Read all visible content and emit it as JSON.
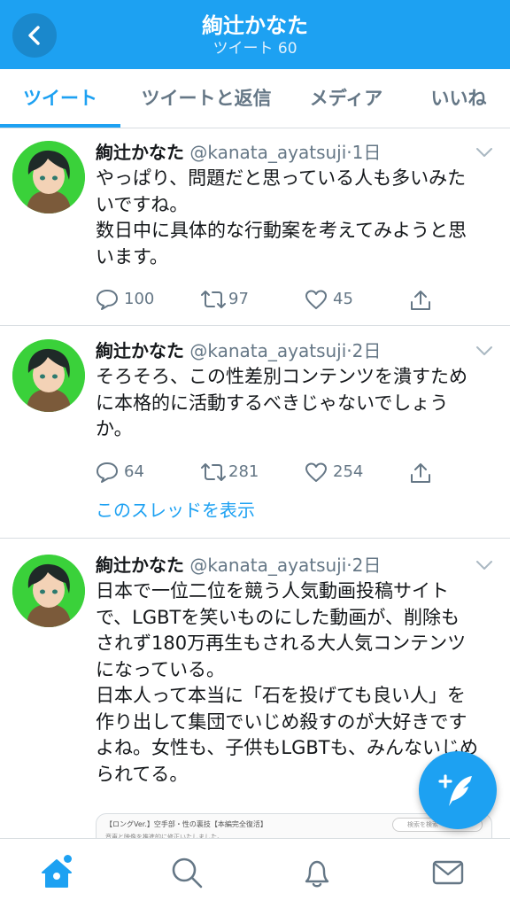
{
  "header": {
    "title": "絢辻かなた",
    "subtitle": "ツイート 60",
    "color": "#1da1f2"
  },
  "tabs": [
    {
      "label": "ツイート",
      "active": true
    },
    {
      "label": "ツイートと返信",
      "active": false
    },
    {
      "label": "メディア",
      "active": false
    },
    {
      "label": "いいね",
      "active": false
    }
  ],
  "tweets": [
    {
      "name": "絢辻かなた",
      "meta": "@kanata_ayatsuji·1日",
      "lines": [
        "やっぱり、問題だと思っている人も多いみた",
        "いですね。",
        "数日中に具体的な行動案を考えてみようと思",
        "います。"
      ],
      "replies": "100",
      "retweets": "97",
      "likes": "45"
    },
    {
      "name": "絢辻かなた",
      "meta": "@kanata_ayatsuji·2日",
      "lines": [
        "そろそろ、この性差別コンテンツを潰すため",
        "に本格的に活動するべきじゃないでしょう",
        "か。"
      ],
      "replies": "64",
      "retweets": "281",
      "likes": "254",
      "thread_link": "このスレッドを表示"
    },
    {
      "name": "絢辻かなた",
      "meta": "@kanata_ayatsuji·2日",
      "lines": [
        "日本で一位二位を競う人気動画投稿サイト",
        "で、LGBTを笑いものにした動画が、削除も",
        "されず180万再生もされる大人気コンテンツ",
        "になっている。",
        "日本人って本当に「石を投げても良い人」を",
        "作り出して集団でいじめ殺すのが大好きです",
        "よね。女性も、子供もLGBTも、みんないじめ",
        "られてる。"
      ],
      "preview": {
        "title": "【ロングVer.】空手部・性の裏技【本編完全復活】",
        "subtitle": "音声と映像を推進的に修正いたしました。",
        "search_placeholder": "検索を検索"
      }
    }
  ],
  "bottom_nav": [
    {
      "icon": "home-icon",
      "active": true
    },
    {
      "icon": "search-icon",
      "active": false
    },
    {
      "icon": "bell-icon",
      "active": false
    },
    {
      "icon": "mail-icon",
      "active": false
    }
  ]
}
